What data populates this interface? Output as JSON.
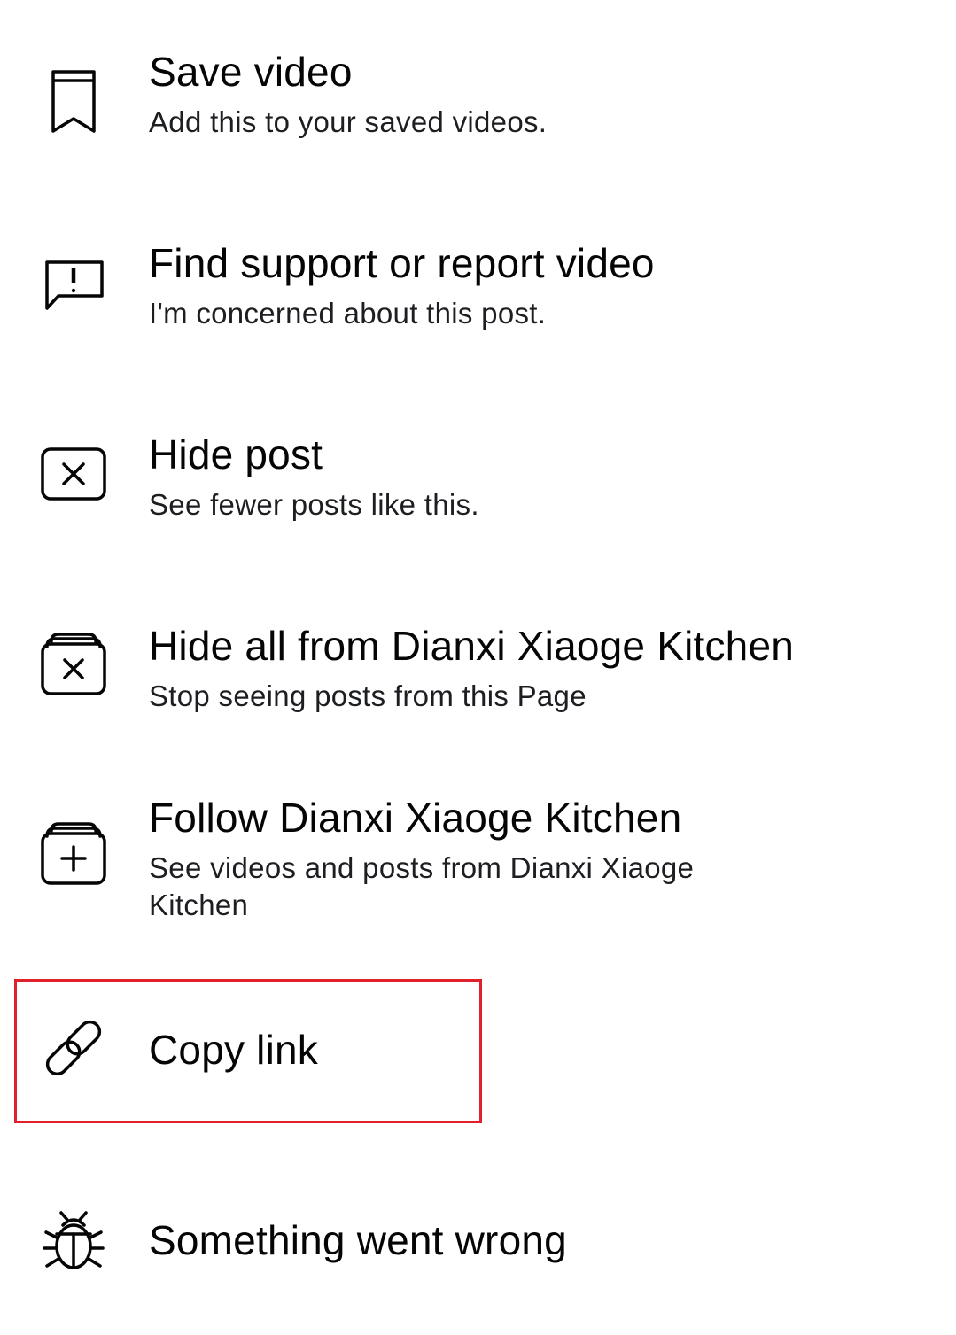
{
  "menu": {
    "items": [
      {
        "title": "Save video",
        "subtitle": "Add this to your saved videos.",
        "icon": "bookmark-icon"
      },
      {
        "title": "Find support or report video",
        "subtitle": "I'm concerned about this post.",
        "icon": "report-icon"
      },
      {
        "title": "Hide post",
        "subtitle": "See fewer posts like this.",
        "icon": "hide-post-icon"
      },
      {
        "title": "Hide all from Dianxi Xiaoge Kitchen",
        "subtitle": "Stop seeing posts from this Page",
        "icon": "hide-all-icon"
      },
      {
        "title": "Follow Dianxi Xiaoge Kitchen",
        "subtitle": "See videos and posts from Dianxi Xiaoge Kitchen",
        "icon": "follow-icon"
      },
      {
        "title": "Copy link",
        "subtitle": "",
        "icon": "link-icon"
      },
      {
        "title": "Something went wrong",
        "subtitle": "",
        "icon": "bug-icon"
      }
    ]
  },
  "colors": {
    "text": "#050505",
    "highlight": "#e0202c",
    "background": "#ffffff"
  }
}
